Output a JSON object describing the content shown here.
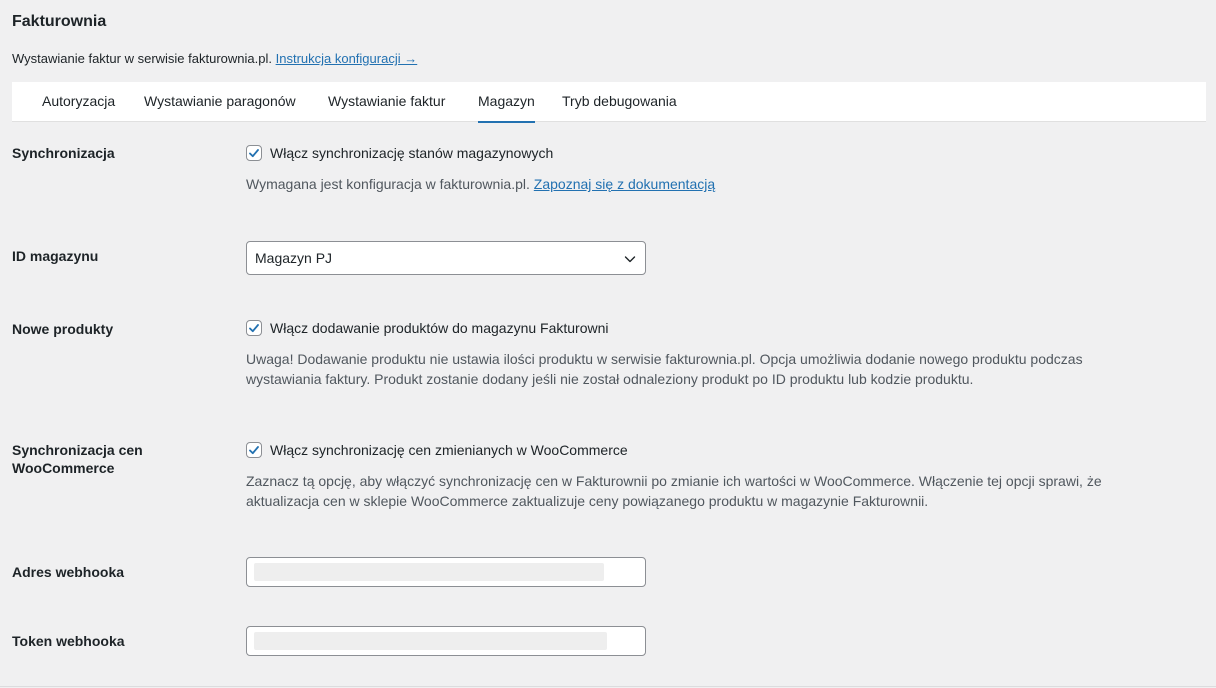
{
  "page": {
    "title": "Fakturownia",
    "intro_text": "Wystawianie faktur w serwisie fakturownia.pl.",
    "intro_link": "Instrukcja konfiguracji →"
  },
  "tabs": [
    {
      "label": "Autoryzacja",
      "active": false
    },
    {
      "label": "Wystawianie paragonów",
      "active": false
    },
    {
      "label": "Wystawianie faktur",
      "active": false
    },
    {
      "label": "Magazyn",
      "active": true
    },
    {
      "label": "Tryb debugowania",
      "active": false
    }
  ],
  "settings": {
    "sync": {
      "label": "Synchronizacja",
      "checkbox_label": "Włącz synchronizację stanów magazynowych",
      "checked": true,
      "desc_text": "Wymagana jest konfiguracja w fakturownia.pl.",
      "desc_link": "Zapoznaj się z dokumentacją"
    },
    "warehouse_id": {
      "label": "ID magazynu",
      "selected": "Magazyn PJ"
    },
    "new_products": {
      "label": "Nowe produkty",
      "checkbox_label": "Włącz dodawanie produktów do magazynu Fakturowni",
      "checked": true,
      "desc": "Uwaga! Dodawanie produktu nie ustawia ilości produktu w serwisie fakturownia.pl. Opcja umożliwia dodanie nowego produktu podczas wystawiania faktury. Produkt zostanie dodany jeśli nie został odnaleziony produkt po ID produktu lub kodzie produktu."
    },
    "price_sync": {
      "label": "Synchronizacja cen WooCommerce",
      "checkbox_label": "Włącz synchronizację cen zmienianych w WooCommerce",
      "checked": true,
      "desc": "Zaznacz tą opcję, aby włączyć synchronizację cen w Fakturownii po zmianie ich wartości w WooCommerce. Włączenie tej opcji sprawi, że aktualizacja cen w sklepie WooCommerce zaktualizuje ceny powiązanego produktu w magazynie Fakturownii."
    },
    "webhook_url": {
      "label": "Adres webhooka",
      "value": ""
    },
    "webhook_token": {
      "label": "Token webhooka",
      "value": ""
    }
  },
  "colors": {
    "accent": "#2271b1",
    "background": "#f0f0f1",
    "text": "#1d2327",
    "muted_text": "#50575e"
  },
  "icons": {
    "checkbox": "checkmark-icon",
    "select": "chevron-down-icon"
  }
}
